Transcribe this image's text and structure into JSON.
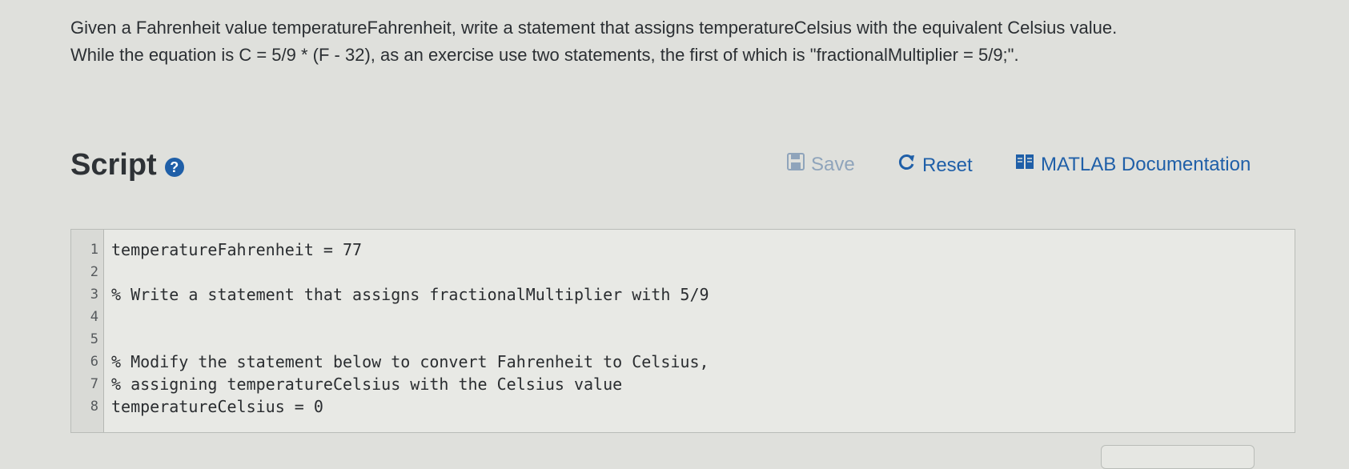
{
  "prompt": {
    "line1": "Given a Fahrenheit value temperatureFahrenheit, write a statement that assigns temperatureCelsius with the equivalent Celsius value.",
    "line2": "While the equation is C = 5/9 * (F - 32), as an exercise use two statements, the first of which is \"fractionalMultiplier = 5/9;\"."
  },
  "script": {
    "title": "Script",
    "help_icon": "question-circle-icon",
    "save_label": "Save",
    "reset_label": "Reset",
    "docs_label": "MATLAB Documentation"
  },
  "editor": {
    "lines": [
      {
        "num": "1",
        "text": "temperatureFahrenheit = 77"
      },
      {
        "num": "2",
        "text": ""
      },
      {
        "num": "3",
        "text": "% Write a statement that assigns fractionalMultiplier with 5/9"
      },
      {
        "num": "4",
        "text": ""
      },
      {
        "num": "5",
        "text": ""
      },
      {
        "num": "6",
        "text": "% Modify the statement below to convert Fahrenheit to Celsius,"
      },
      {
        "num": "7",
        "text": "% assigning temperatureCelsius with the Celsius value"
      },
      {
        "num": "8",
        "text": "temperatureCelsius = 0"
      }
    ]
  },
  "colors": {
    "accent": "#1f5fa8",
    "disabled": "#8fa4bb",
    "background": "#dfe0dc"
  }
}
